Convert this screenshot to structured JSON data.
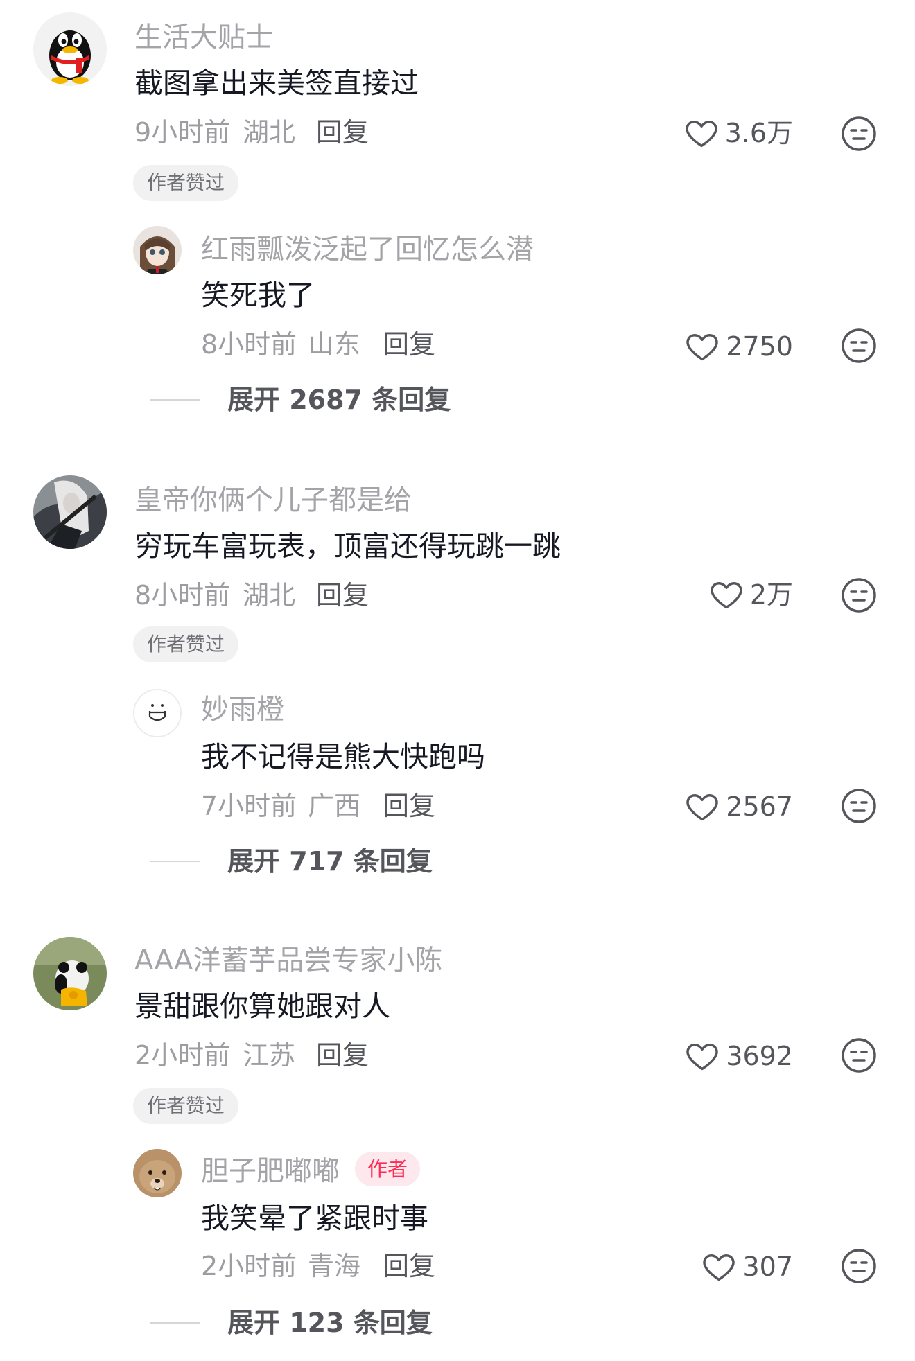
{
  "colors": {
    "username": "#a3a3a8",
    "content": "#161823",
    "meta": "#9c9ca1",
    "accent": "#fe2c55",
    "badge_bg": "#f1f1f2"
  },
  "comments": [
    {
      "username": "生活大贴士",
      "content": "截图拿出来美签直接过",
      "time": "9小时前",
      "location": "湖北",
      "reply_label": "回复",
      "likes": "3.6万",
      "liked_by_author_label": "作者赞过",
      "reply": {
        "username": "红雨瓢泼泛起了回忆怎么潜",
        "content": "笑死我了",
        "time": "8小时前",
        "location": "山东",
        "reply_label": "回复",
        "likes": "2750"
      },
      "expand_label": "展开 2687 条回复"
    },
    {
      "username": "皇帝你俩个儿子都是给",
      "content": "穷玩车富玩表，顶富还得玩跳一跳",
      "time": "8小时前",
      "location": "湖北",
      "reply_label": "回复",
      "likes": "2万",
      "liked_by_author_label": "作者赞过",
      "reply": {
        "username": "妙雨橙",
        "content": "我不记得是熊大快跑吗",
        "time": "7小时前",
        "location": "广西",
        "reply_label": "回复",
        "likes": "2567"
      },
      "expand_label": "展开 717 条回复"
    },
    {
      "username": "AAA洋蓄芋品尝专家小陈",
      "content": "景甜跟你算她跟对人",
      "time": "2小时前",
      "location": "江苏",
      "reply_label": "回复",
      "likes": "3692",
      "liked_by_author_label": "作者赞过",
      "reply": {
        "username": "胆子肥嘟嘟",
        "author_tag": "作者",
        "content": "我笑晕了紧跟时事",
        "time": "2小时前",
        "location": "青海",
        "reply_label": "回复",
        "likes": "307"
      },
      "expand_label": "展开 123 条回复"
    }
  ]
}
